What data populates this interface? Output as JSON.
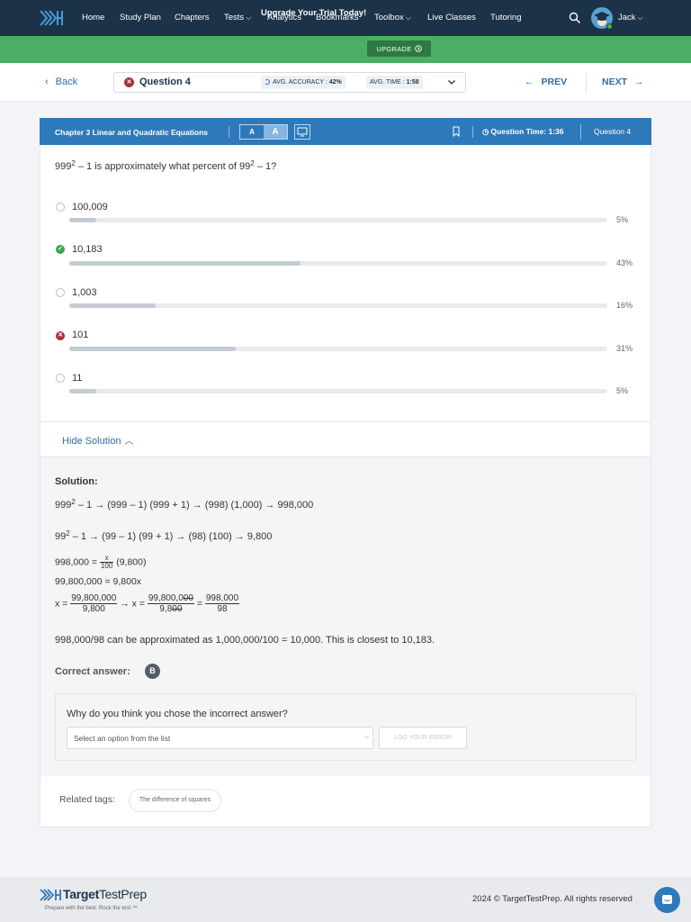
{
  "nav": {
    "items": [
      "Home",
      "Study Plan",
      "Chapters",
      "Tests",
      "Analytics",
      "Bookmarks",
      "Toolbox",
      "Live Classes",
      "Tutoring"
    ],
    "user": "Jack"
  },
  "banner": {
    "text": "Upgrade Your Trial Today!",
    "button": "UPGRADE"
  },
  "qbar": {
    "back": "Back",
    "question_title": "Question 4",
    "accuracy_label": "AVG. ACCURACY :",
    "accuracy_value": "42%",
    "time_label": "AVG. TIME :",
    "time_value": "1:58",
    "prev": "PREV",
    "next": "NEXT"
  },
  "card": {
    "chapter": "Chapter 3 Linear and Quadratic Equations",
    "font_small": "A",
    "font_large": "A",
    "question_time": "Question Time: 1:36",
    "question_num": "Question 4"
  },
  "question": {
    "stem_a": "999",
    "stem_b": " – 1 is approximately what percent of 99",
    "stem_c": " – 1?",
    "exp": "2"
  },
  "options": [
    {
      "label": "100,009",
      "pct": "5%",
      "fill": 0.05,
      "state": "none"
    },
    {
      "label": "10,183",
      "pct": "43%",
      "fill": 0.43,
      "state": "correct"
    },
    {
      "label": "1,003",
      "pct": "16%",
      "fill": 0.16,
      "state": "none"
    },
    {
      "label": "101",
      "pct": "31%",
      "fill": 0.31,
      "state": "wrong"
    },
    {
      "label": "11",
      "pct": "5%",
      "fill": 0.05,
      "state": "none"
    }
  ],
  "solution": {
    "toggle": "Hide Solution",
    "title": "Solution:",
    "line1_a": "999",
    "line1_b": " – 1 →  (999 – 1) (999 + 1) →  (998) (1,000) → 998,000",
    "line2_a": "99",
    "line2_b": " – 1 →  (99 – 1) (99 + 1) →  (98) (100) → 9,800",
    "line3_a": "998,000 = ",
    "line3_num": "x",
    "line3_den": "100",
    "line3_b": " (9,800)",
    "line4": "99,800,000 = 9,800x",
    "line5_x": "x = ",
    "line5_f1_num": "99,800,000",
    "line5_f1_den": "9,800",
    "line5_arrow": " → x = ",
    "line5_f2_num": "99,800,0",
    "line5_f2_num_strike": "00",
    "line5_f2_den": "9,8",
    "line5_f2_den_strike": "00",
    "line5_eq": " = ",
    "line5_f3_num": "998,000",
    "line5_f3_den": "98",
    "line6": "998,000/98 can be approximated as 1,000,000/100 = 10,000. This is closest to 10,183.",
    "correct_label": "Correct answer:",
    "correct_letter": "B"
  },
  "why": {
    "question": "Why do you think you chose the incorrect answer?",
    "select_placeholder": "Select an option from the list",
    "log_button": "LOG YOUR ERROR"
  },
  "tags": {
    "label": "Related tags:",
    "items": [
      "The difference of squares"
    ]
  },
  "footer": {
    "brand_bold": "Target",
    "brand_light": "TestPrep",
    "tagline": "Prepare with the best. Rock the test.™",
    "copyright": "2024 © TargetTestPrep. All rights reserved"
  },
  "colors": {
    "navy": "#1b3249",
    "green": "#4cae64",
    "blue": "#2e79ba",
    "correct": "#3aa356",
    "wrong": "#a8323a"
  }
}
